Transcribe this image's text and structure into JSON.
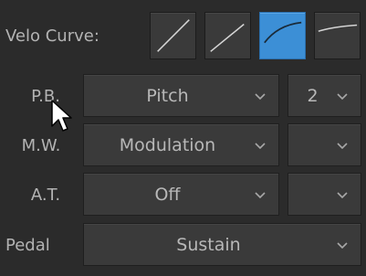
{
  "velo_curve": {
    "label": "Velo Curve:",
    "options": [
      {
        "curve": "linear-icon",
        "selected": false
      },
      {
        "curve": "soft-linear-icon",
        "selected": false
      },
      {
        "curve": "hard-curve-icon",
        "selected": true
      },
      {
        "curve": "flat-curve-icon",
        "selected": false
      }
    ]
  },
  "rows": [
    {
      "label": "P.B.",
      "value": "Pitch",
      "secondary": "2"
    },
    {
      "label": "M.W.",
      "value": "Modulation",
      "secondary": ""
    },
    {
      "label": "A.T.",
      "value": "Off",
      "secondary": ""
    },
    {
      "label": "Pedal",
      "value": "Sustain"
    }
  ],
  "colors": {
    "background": "#2b2b2b",
    "control": "#3a3a3a",
    "accent": "#3c8fd6",
    "text": "#b8b8b8"
  },
  "icons": {
    "dropdown": "chevron-down-icon",
    "pointer": "mouse-pointer-icon"
  }
}
